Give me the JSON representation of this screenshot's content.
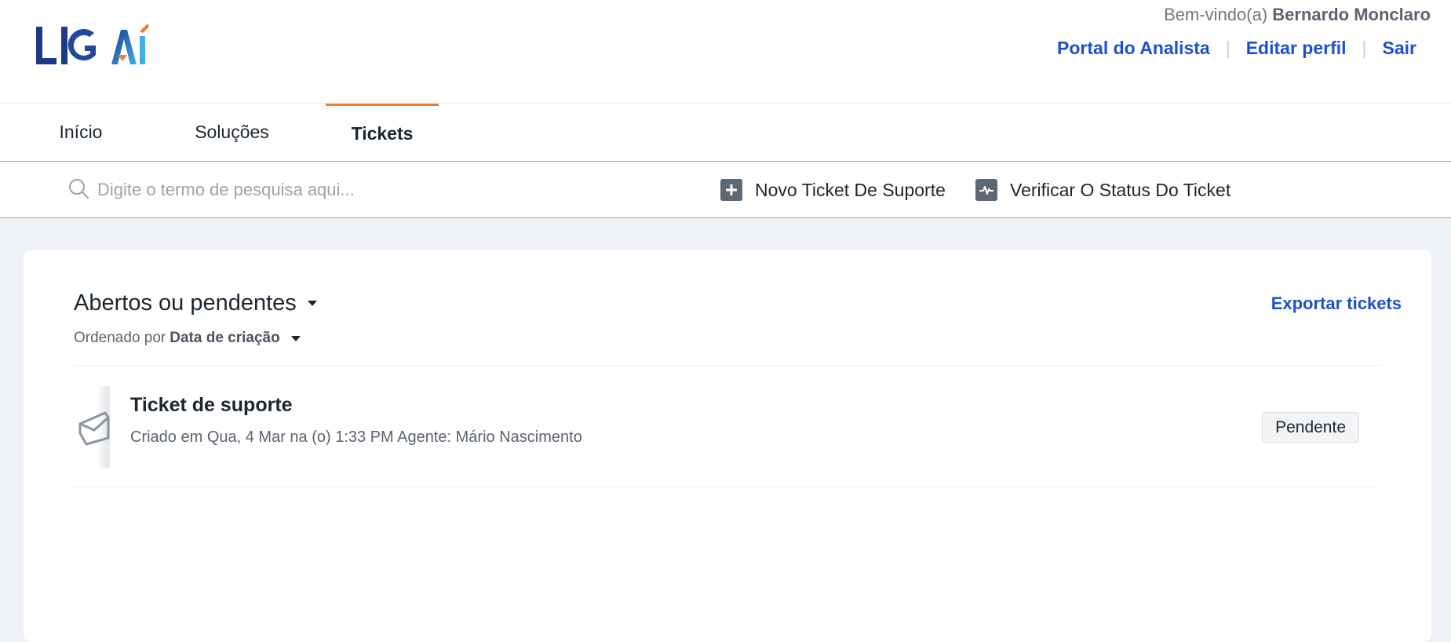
{
  "brand": {
    "logo_text": "LIGAI",
    "accent": "#f07e2e",
    "link": "#1f4fd1"
  },
  "user": {
    "welcome_prefix": "Bem-vindo(a)",
    "name": "Bernardo Monclaro"
  },
  "top_links": {
    "analyst_portal": "Portal do Analista",
    "edit_profile": "Editar perfil",
    "logout": "Sair"
  },
  "nav": {
    "tabs": [
      {
        "label": "Início",
        "active": false
      },
      {
        "label": "Soluções",
        "active": false
      },
      {
        "label": "Tickets",
        "active": true
      }
    ]
  },
  "search": {
    "placeholder": "Digite o termo de pesquisa aqui...",
    "value": ""
  },
  "actions": {
    "new_ticket": "Novo Ticket De Suporte",
    "check_status": "Verificar O Status Do Ticket"
  },
  "tickets": {
    "filter": "Abertos ou pendentes",
    "sort_prefix": "Ordenado por",
    "sort_field": "Data de criação",
    "export_label": "Exportar tickets",
    "items": [
      {
        "title": "Ticket de suporte",
        "meta": "Criado em Qua, 4 Mar na (o) 1:33 PM Agente: Mário Nascimento",
        "status": "Pendente"
      }
    ]
  }
}
